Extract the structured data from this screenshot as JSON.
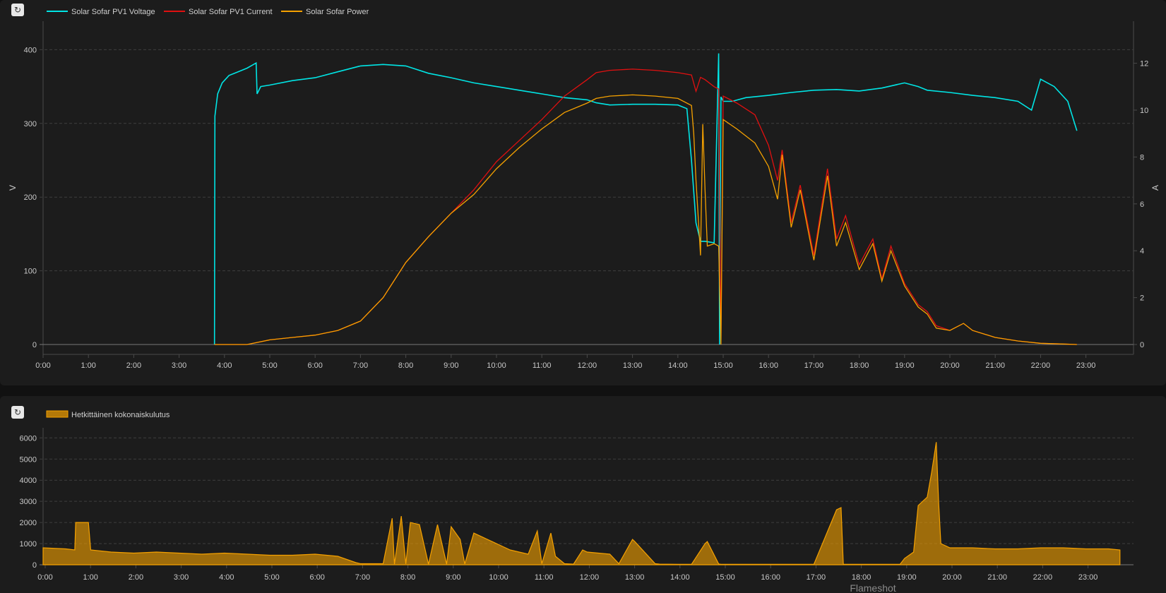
{
  "chart_data": [
    {
      "type": "line",
      "legend": [
        "Solar Sofar PV1 Voltage",
        "Solar Sofar PV1 Current",
        "Solar Sofar Power"
      ],
      "colors": {
        "voltage": "#00e5e5",
        "current": "#e01010",
        "power": "#f5a100"
      },
      "xlabel": "",
      "ylabel_left": "V",
      "ylabel_right": "A",
      "x_ticks": [
        "0:00",
        "1:00",
        "2:00",
        "3:00",
        "4:00",
        "5:00",
        "6:00",
        "7:00",
        "8:00",
        "9:00",
        "10:00",
        "11:00",
        "12:00",
        "13:00",
        "14:00",
        "15:00",
        "16:00",
        "17:00",
        "18:00",
        "19:00",
        "20:00",
        "21:00",
        "22:00",
        "23:00"
      ],
      "y_left_ticks": [
        "0",
        "100",
        "200",
        "300",
        "400"
      ],
      "y_right_ticks": [
        "0",
        "2",
        "4",
        "6",
        "8",
        "10",
        "12"
      ],
      "ylim_left": [
        0,
        400
      ],
      "ylim_right": [
        0,
        12.5
      ],
      "xlim_hours": [
        0,
        23.75
      ],
      "grid": true,
      "legend_position": "top-left",
      "series": [
        {
          "name": "Solar Sofar PV1 Voltage",
          "axis": "left",
          "x_hours": [
            3.78,
            3.79,
            3.85,
            3.95,
            4.1,
            4.3,
            4.5,
            4.7,
            4.72,
            4.8,
            5.0,
            5.5,
            6.0,
            6.5,
            7.0,
            7.5,
            8.0,
            8.5,
            9.0,
            9.5,
            10.0,
            10.5,
            11.0,
            11.5,
            12.0,
            12.2,
            12.5,
            13.0,
            13.5,
            14.0,
            14.2,
            14.3,
            14.4,
            14.5,
            14.6,
            14.8,
            14.9,
            14.92,
            14.95,
            15.0,
            15.2,
            15.5,
            16.0,
            16.5,
            17.0,
            17.5,
            18.0,
            18.5,
            19.0,
            19.3,
            19.5,
            20.0,
            20.5,
            21.0,
            21.5,
            21.8,
            22.0,
            22.3,
            22.6,
            22.8
          ],
          "values": [
            0,
            310,
            340,
            355,
            365,
            370,
            375,
            382,
            340,
            350,
            352,
            358,
            362,
            370,
            378,
            380,
            378,
            368,
            362,
            355,
            350,
            345,
            340,
            335,
            332,
            328,
            325,
            326,
            326,
            325,
            320,
            250,
            165,
            140,
            140,
            138,
            395,
            0,
            336,
            330,
            330,
            335,
            338,
            342,
            345,
            346,
            344,
            348,
            355,
            350,
            345,
            342,
            338,
            335,
            330,
            318,
            360,
            350,
            330,
            290
          ]
        },
        {
          "name": "Solar Sofar PV1 Current",
          "axis": "right",
          "x_hours": [
            3.78,
            4.5,
            5.0,
            5.5,
            6.0,
            6.5,
            7.0,
            7.5,
            8.0,
            8.5,
            9.0,
            9.5,
            10.0,
            10.5,
            11.0,
            11.5,
            12.0,
            12.2,
            12.5,
            13.0,
            13.5,
            14.0,
            14.3,
            14.4,
            14.5,
            14.6,
            14.8,
            14.9,
            14.95,
            15.0,
            15.3,
            15.7,
            16.0,
            16.2,
            16.3,
            16.5,
            16.7,
            17.0,
            17.3,
            17.5,
            17.7,
            18.0,
            18.3,
            18.5,
            18.7,
            19.0,
            19.3,
            19.5,
            19.7,
            20.0,
            20.3,
            20.5,
            21.0,
            21.5,
            22.0,
            22.5,
            22.8
          ],
          "values": [
            0,
            0,
            0.2,
            0.3,
            0.4,
            0.6,
            1.0,
            2.0,
            3.5,
            4.6,
            5.6,
            6.6,
            7.8,
            8.7,
            9.6,
            10.6,
            11.3,
            11.6,
            11.7,
            11.75,
            11.7,
            11.6,
            11.5,
            10.8,
            11.4,
            11.3,
            11.0,
            10.9,
            0,
            10.6,
            10.3,
            9.8,
            8.5,
            7.0,
            8.3,
            5.2,
            6.8,
            3.8,
            7.5,
            4.5,
            5.5,
            3.4,
            4.5,
            2.8,
            4.2,
            2.6,
            1.7,
            1.4,
            0.8,
            0.6,
            0.9,
            0.6,
            0.3,
            0.15,
            0.05,
            0.02,
            0
          ]
        },
        {
          "name": "Solar Sofar Power",
          "axis": "right",
          "x_hours": [
            3.78,
            4.5,
            5.0,
            5.5,
            6.0,
            6.5,
            7.0,
            7.5,
            8.0,
            8.5,
            9.0,
            9.5,
            10.0,
            10.5,
            11.0,
            11.5,
            12.0,
            12.2,
            12.5,
            13.0,
            13.5,
            14.0,
            14.3,
            14.35,
            14.4,
            14.5,
            14.55,
            14.6,
            14.65,
            14.8,
            14.9,
            14.95,
            15.0,
            15.3,
            15.7,
            16.0,
            16.2,
            16.3,
            16.5,
            16.7,
            17.0,
            17.3,
            17.5,
            17.7,
            18.0,
            18.3,
            18.5,
            18.7,
            19.0,
            19.3,
            19.5,
            19.7,
            20.0,
            20.3,
            20.5,
            21.0,
            21.5,
            22.0,
            22.5,
            22.8
          ],
          "values": [
            0,
            0,
            0.2,
            0.3,
            0.4,
            0.6,
            1.0,
            2.0,
            3.5,
            4.6,
            5.6,
            6.4,
            7.5,
            8.4,
            9.2,
            9.9,
            10.3,
            10.5,
            10.6,
            10.65,
            10.6,
            10.5,
            10.2,
            9.0,
            7.0,
            3.8,
            9.4,
            6.6,
            4.2,
            4.3,
            4.2,
            0,
            9.6,
            9.2,
            8.6,
            7.6,
            6.2,
            8.1,
            5.0,
            6.6,
            3.6,
            7.2,
            4.2,
            5.2,
            3.2,
            4.3,
            2.7,
            4.0,
            2.5,
            1.6,
            1.3,
            0.7,
            0.6,
            0.9,
            0.6,
            0.3,
            0.15,
            0.05,
            0.02,
            0
          ]
        }
      ]
    },
    {
      "type": "area",
      "legend": [
        "Hetkittäinen kokonaiskulutus"
      ],
      "colors": {
        "consumption": "#f5a100"
      },
      "x_ticks": [
        "0:00",
        "1:00",
        "2:00",
        "3:00",
        "4:00",
        "5:00",
        "6:00",
        "7:00",
        "8:00",
        "9:00",
        "10:00",
        "11:00",
        "12:00",
        "13:00",
        "14:00",
        "15:00",
        "16:00",
        "17:00",
        "18:00",
        "19:00",
        "20:00",
        "21:00",
        "22:00",
        "23:00"
      ],
      "y_ticks": [
        "0",
        "1000",
        "2000",
        "3000",
        "4000",
        "5000",
        "6000"
      ],
      "ylim": [
        0,
        6500
      ],
      "xlim_hours": [
        0,
        23.75
      ],
      "grid": true,
      "legend_position": "top-left",
      "series": [
        {
          "name": "Hetkittäinen kokonaiskulutus",
          "x_hours": [
            0,
            0.5,
            0.7,
            0.72,
            1.0,
            1.05,
            1.5,
            2.0,
            2.5,
            3.0,
            3.5,
            4.0,
            4.5,
            5.0,
            5.5,
            6.0,
            6.5,
            6.9,
            7.0,
            7.5,
            7.7,
            7.75,
            7.9,
            8.0,
            8.1,
            8.3,
            8.5,
            8.7,
            8.9,
            9.0,
            9.2,
            9.3,
            9.5,
            9.7,
            9.9,
            10.1,
            10.3,
            10.5,
            10.7,
            10.9,
            11.0,
            11.2,
            11.3,
            11.5,
            11.7,
            11.9,
            12.0,
            12.5,
            12.7,
            13.0,
            13.05,
            13.5,
            13.6,
            14.0,
            14.3,
            14.6,
            14.65,
            14.9,
            14.95,
            15.2,
            15.5,
            16.0,
            16.5,
            17.0,
            17.5,
            17.6,
            17.65,
            17.8,
            17.85,
            18.0,
            18.5,
            18.9,
            19.0,
            19.2,
            19.3,
            19.5,
            19.6,
            19.7,
            19.75,
            19.8,
            19.9,
            20.0,
            20.5,
            21.0,
            21.5,
            22.0,
            22.5,
            23.0,
            23.5,
            23.75
          ],
          "values": [
            800,
            750,
            700,
            2000,
            2000,
            700,
            600,
            550,
            600,
            550,
            500,
            550,
            500,
            450,
            450,
            500,
            400,
            100,
            50,
            50,
            2200,
            30,
            2300,
            40,
            2000,
            1900,
            30,
            1900,
            30,
            1800,
            1200,
            40,
            1500,
            1300,
            1100,
            900,
            700,
            600,
            500,
            1600,
            50,
            1500,
            400,
            50,
            30,
            700,
            600,
            500,
            50,
            1200,
            1100,
            50,
            30,
            20,
            20,
            1000,
            1100,
            40,
            20,
            20,
            20,
            20,
            20,
            20,
            2600,
            2700,
            20,
            20,
            20,
            20,
            20,
            20,
            300,
            600,
            2800,
            3200,
            4400,
            5800,
            3000,
            1000,
            900,
            800,
            800,
            750,
            750,
            800,
            800,
            750,
            750,
            700
          ]
        }
      ]
    }
  ],
  "watermark": "Flameshot",
  "refresh_icon": "refresh-icon",
  "refresh_glyph": "↻"
}
